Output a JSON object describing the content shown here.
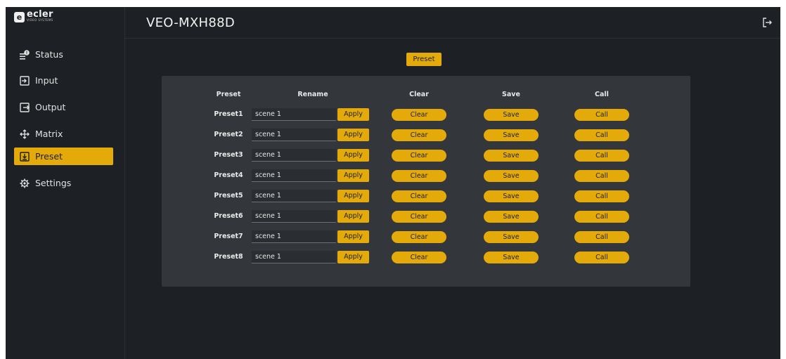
{
  "brand": {
    "logo_mark": "e",
    "logo_word": "ecler",
    "logo_sub": "VIDEO SYSTEMS"
  },
  "header": {
    "device_name": "VEO-MXH88D"
  },
  "sidebar": {
    "items": [
      {
        "label": "Status",
        "icon": "status-icon",
        "active": false
      },
      {
        "label": "Input",
        "icon": "input-icon",
        "active": false
      },
      {
        "label": "Output",
        "icon": "output-icon",
        "active": false
      },
      {
        "label": "Matrix",
        "icon": "matrix-icon",
        "active": false
      },
      {
        "label": "Preset",
        "icon": "preset-icon",
        "active": true
      },
      {
        "label": "Settings",
        "icon": "settings-icon",
        "active": false
      }
    ]
  },
  "main": {
    "tab_label": "Preset",
    "columns": [
      "Preset",
      "Rename",
      "Clear",
      "Save",
      "Call"
    ],
    "apply_label": "Apply",
    "clear_label": "Clear",
    "save_label": "Save",
    "call_label": "Call",
    "rows": [
      {
        "label": "Preset1",
        "name": "scene 1"
      },
      {
        "label": "Preset2",
        "name": "scene 1"
      },
      {
        "label": "Preset3",
        "name": "scene 1"
      },
      {
        "label": "Preset4",
        "name": "scene 1"
      },
      {
        "label": "Preset5",
        "name": "scene 1"
      },
      {
        "label": "Preset6",
        "name": "scene 1"
      },
      {
        "label": "Preset7",
        "name": "scene 1"
      },
      {
        "label": "Preset8",
        "name": "scene 1"
      }
    ]
  },
  "colors": {
    "accent": "#e3aa0a",
    "background": "#1d2024",
    "panel": "#33373c"
  }
}
